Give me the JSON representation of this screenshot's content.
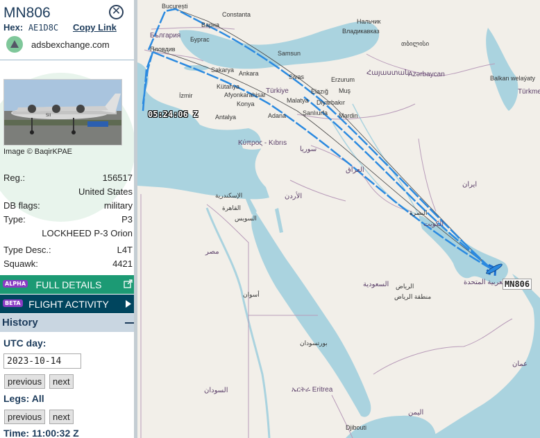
{
  "aircraft": {
    "callsign": "MN806",
    "hex_label": "Hex:",
    "hex_value": "AE1D8C",
    "copy_link_label": "Copy Link",
    "source": "adsbexchange.com",
    "image_credit": "Image © BaqirKPAE"
  },
  "details": {
    "reg_label": "Reg.:",
    "reg_value": "156517",
    "country": "United States",
    "dbflags_label": "DB flags:",
    "dbflags_value": "military",
    "type_label": "Type:",
    "type_value": "P3",
    "type_name": "LOCKHEED P-3 Orion",
    "typedesc_label": "Type Desc.:",
    "typedesc_value": "L4T",
    "squawk_label": "Squawk:",
    "squawk_value": "4421"
  },
  "buttons": {
    "full_details_tag": "ALPHA",
    "full_details_label": "FULL DETAILS",
    "flight_activity_tag": "BETA",
    "flight_activity_label": "FLIGHT ACTIVITY"
  },
  "history": {
    "title": "History",
    "utc_day_label": "UTC day:",
    "date_value": "2023-10-14",
    "previous_label": "previous",
    "next_label": "next",
    "legs_label": "Legs: All",
    "time_label": "Time: 11:00:32 Z"
  },
  "map": {
    "time_marker": "05:24:06 Z",
    "aircraft_label": "MN806",
    "track_color": "#2b8ae0",
    "labels": {
      "bucuresti": "București",
      "constanta": "Constanta",
      "varna": "Варна",
      "burgas": "Бургас",
      "bulgaria": "България",
      "plovdiv": "Пловдив",
      "samsun": "Samsun",
      "sakarya": "Sakarya",
      "ankara": "Ankara",
      "sivas": "Sivas",
      "kutahya": "Kütahya",
      "afyon": "Afyonkarahisar",
      "turkiye": "Türkiye",
      "konya": "Konya",
      "izmir": "İzmir",
      "elazig": "Elazığ",
      "mus": "Muş",
      "erzurum": "Erzurum",
      "malatya": "Malatya",
      "diyarbakir": "Diyarbakır",
      "adana": "Adana",
      "sanliurfa": "Şanlıurfa",
      "mardin": "Mardin",
      "antalya": "Antalya",
      "cyprus": "Κύπρος - Kıbrıs",
      "tbilisi": "თბილისი",
      "vladikavkaz": "Владикавказ",
      "nalchik": "Нальчик",
      "armenia": "Հայաստան",
      "azerbaijan": "Azərbaycan",
      "balkan": "Balkan welaýaty",
      "turkmenistan": "Türkmen",
      "iran": "ایران",
      "iraq": "العراق",
      "syria": "سوريا",
      "jordan": "الأردن",
      "kuwait": "الكويت",
      "basra": "البصرة",
      "saudi": "السعودية",
      "riyadh": "الرياض",
      "egypt": "مصر",
      "cairo": "القاهرة",
      "alexandria": "الإسكندرية",
      "suez": "السويس",
      "sudan": "السودان",
      "eritrea": "ኤርትራ Eritrea",
      "djibouti": "Djibouti",
      "uae": "الإمارات العربية المتحدة",
      "oman": "عمان",
      "yemen": "اليمن",
      "aswan": "أسوان",
      "port_sudan": "بورتسودان",
      "red_sea_region": "منطقة الرياض"
    }
  }
}
